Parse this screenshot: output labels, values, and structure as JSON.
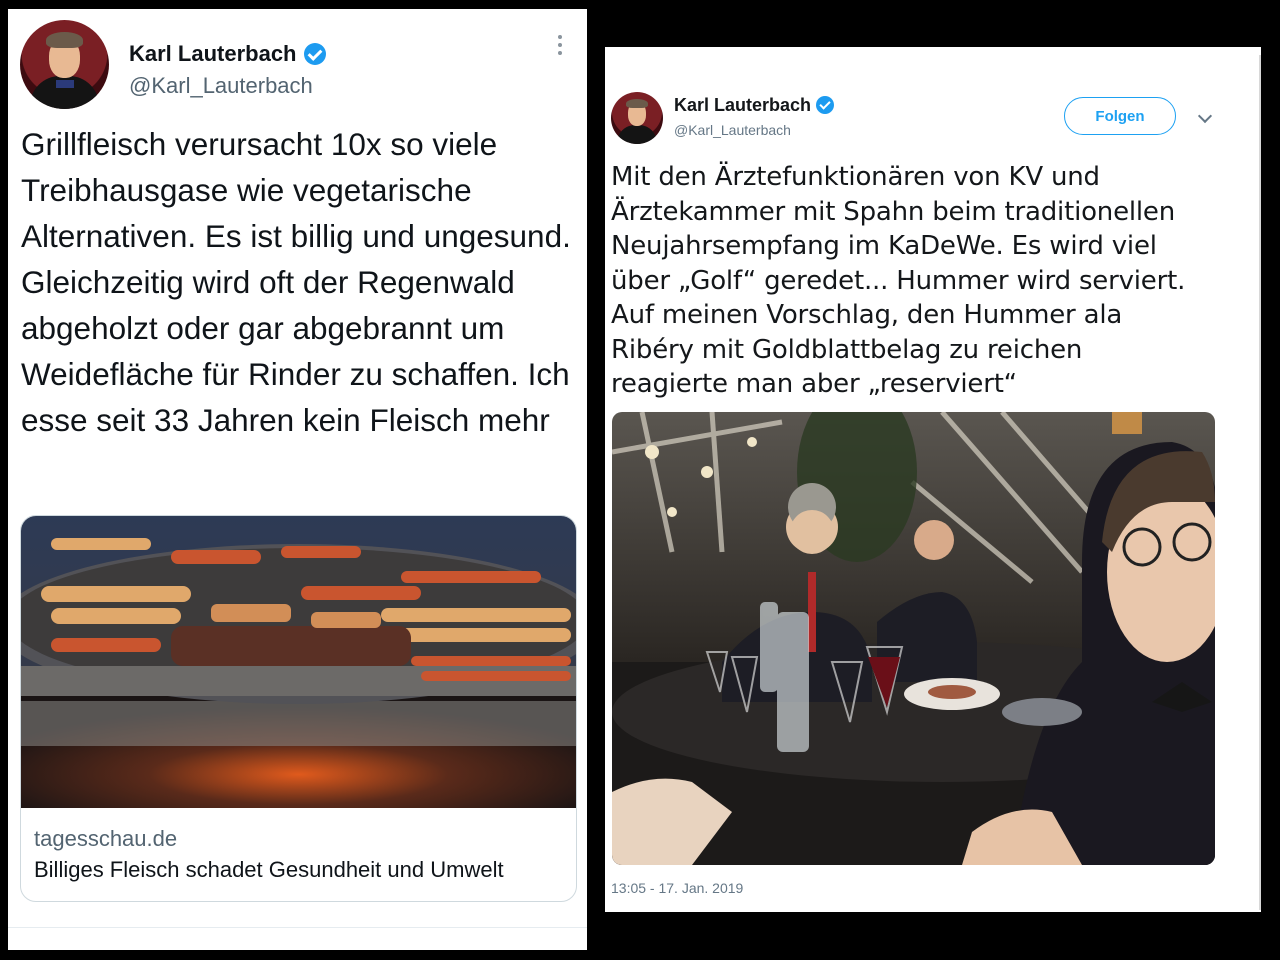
{
  "left_tweet": {
    "author_name": "Karl Lauterbach",
    "handle": "@Karl_Lauterbach",
    "text": "Grillfleisch verursacht 10x so viele Treibhausgase wie vegetarische Alternativen. Es ist billig und ungesund. Gleichzeitig wird oft der Regenwald abgeholzt oder gar abgebrannt um Weidefläche für Rinder zu schaffen. Ich esse seit 33 Jahren kein Fleisch mehr",
    "card": {
      "domain": "tagesschau.de",
      "title": "Billiges Fleisch schadet Gesundheit und Umwelt",
      "image": "grill-with-sausages-and-meat"
    },
    "icons": [
      "verified-badge-icon",
      "more-options-icon"
    ]
  },
  "right_tweet": {
    "author_name": "Karl Lauterbach",
    "handle": "@Karl_Lauterbach",
    "follow_label": "Folgen",
    "lines": [
      "Mit den Ärztefunktionären von KV und",
      "Ärztekammer mit Spahn beim traditionellen",
      "Neujahrsempfang im KaDeWe. Es wird viel",
      "über „Golf“ geredet... Hummer wird serviert.",
      "Auf meinen Vorschlag, den Hummer ala",
      "Ribéry mit Goldblattbelag zu reichen",
      "reagierte man aber „reserviert“"
    ],
    "photo": "restaurant-dinner-selfie",
    "timestamp": "13:05 - 17. Jan. 2019",
    "icons": [
      "verified-badge-icon",
      "chevron-down-icon"
    ]
  },
  "colors": {
    "accent": "#1da1f2",
    "verified": "#1d9bf0",
    "frame": "#000000"
  }
}
